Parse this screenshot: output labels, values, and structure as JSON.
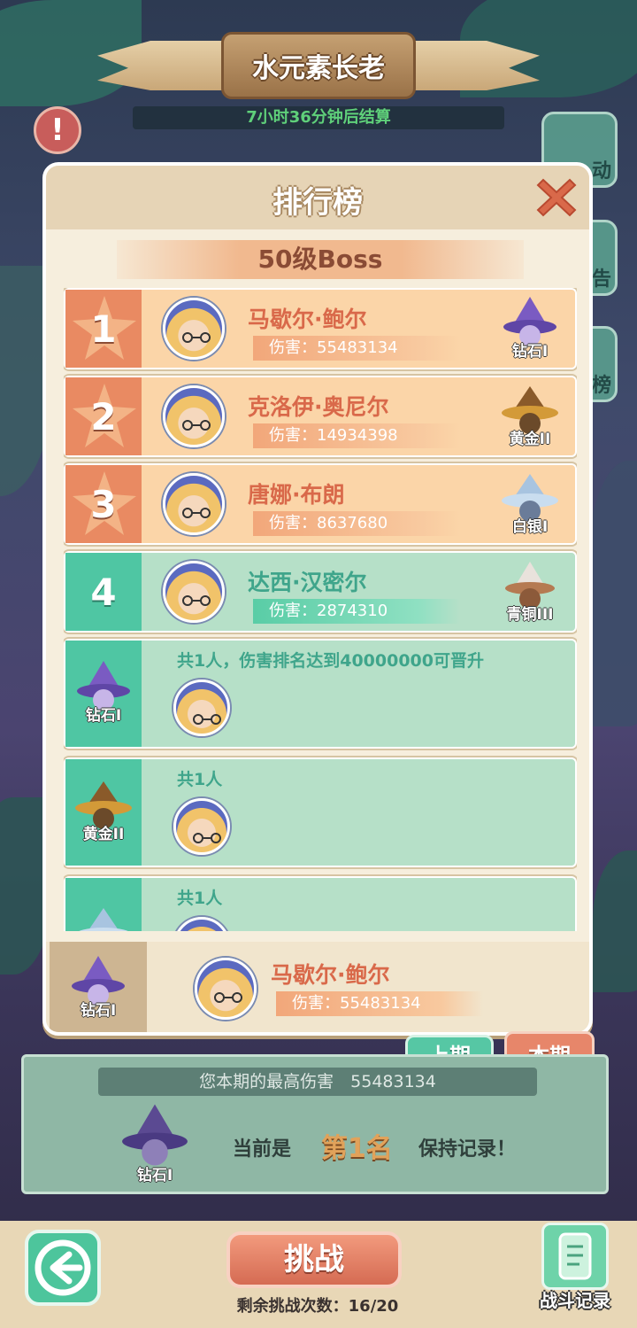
{
  "header": {
    "title": "水元素长老",
    "timer": "7小时36分钟后结算"
  },
  "side_buttons": [
    {
      "label": "动"
    },
    {
      "label": "预告"
    },
    {
      "label": "榜"
    }
  ],
  "dialog": {
    "title": "排行榜",
    "level_label": "50级Boss",
    "ranked": [
      {
        "rank": "1",
        "name": "马歇尔·鲍尔",
        "damage": "伤害：55483134",
        "tier": "钻石I"
      },
      {
        "rank": "2",
        "name": "克洛伊·奥尼尔",
        "damage": "伤害：14934398",
        "tier": "黄金II"
      },
      {
        "rank": "3",
        "name": "唐娜·布朗",
        "damage": "伤害：8637680",
        "tier": "白银I"
      },
      {
        "rank": "4",
        "name": "达西·汉密尔",
        "damage": "伤害：2874310",
        "tier": "青铜III"
      }
    ],
    "tiers": [
      {
        "tier": "钻石I",
        "note": "共1人，伤害排名达到40000000可晋升"
      },
      {
        "tier": "黄金II",
        "note": "共1人"
      },
      {
        "tier": "",
        "note": "共1人"
      }
    ],
    "mine": {
      "tier": "钻石I",
      "name": "马歇尔·鲍尔",
      "damage": "伤害：55483134"
    }
  },
  "tabs": {
    "prev": "上期",
    "current": "本期"
  },
  "summary": {
    "best_damage": "您本期的最高伤害　55483134",
    "tier": "钻石I",
    "current_prefix": "当前是",
    "rank": "第1名",
    "suffix": "保持记录！"
  },
  "footer": {
    "challenge": "挑战",
    "remaining": "剩余挑战次数：16/20",
    "battle_record": "战斗记录"
  },
  "colors": {
    "gold_row": "#fbd5a8",
    "green_row": "#b6e0c8",
    "accent_orange": "#e98a62",
    "accent_green": "#4fc6a3"
  }
}
